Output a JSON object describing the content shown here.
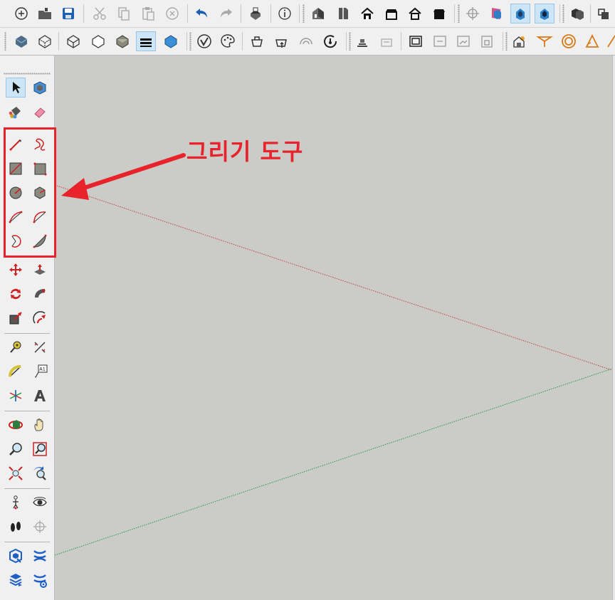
{
  "annotation": {
    "label": "그리기 도구",
    "color": "#e8232b"
  },
  "text_tool_label": "A1",
  "toolbar_top": [
    "new-file-icon",
    "open-folder-icon",
    "save-icon",
    "cut-icon",
    "copy-icon",
    "paste-icon",
    "erase-icon",
    "undo-icon",
    "redo-icon",
    "print-icon",
    "model-info-icon",
    "iso-view-icon",
    "top-view-icon",
    "front-view-icon",
    "right-view-icon",
    "back-view-icon",
    "left-view-icon",
    "previous-view-icon",
    "section-plane-icon",
    "display-section-planes-icon",
    "display-section-cuts-icon",
    "components-icon",
    "groups-icon"
  ],
  "toolbar_styles": [
    "xray-icon",
    "back-edges-icon",
    "wireframe-icon",
    "hidden-line-icon",
    "shaded-icon",
    "shaded-with-textures-icon",
    "monochrome-icon",
    "warehouse-icon",
    "extension-warehouse-icon",
    "share-model-icon",
    "share-component-icon",
    "extension-manager-icon",
    "add-location-icon",
    "toggle-terrain-icon",
    "sandbox-icon",
    "section-fill-icon",
    "photo-match-icon",
    "lock-icon",
    "shadow-settings-icon",
    "fog-icon",
    "soften-icon",
    "protractor-icon"
  ],
  "left_tools": [
    "select-tool",
    "make-component-tool",
    "paint-bucket-tool",
    "eraser-tool",
    "line-tool",
    "freehand-tool",
    "rectangle-tool",
    "rotated-rectangle-tool",
    "circle-tool",
    "polygon-tool",
    "arc-tool",
    "two-point-arc-tool",
    "three-point-arc-tool",
    "pie-tool",
    "move-tool",
    "push-pull-tool",
    "rotate-tool",
    "follow-me-tool",
    "scale-tool",
    "offset-tool",
    "tape-measure-tool",
    "dimension-tool",
    "protractor-tool",
    "text-tool",
    "axes-tool",
    "3d-text-tool",
    "orbit-tool",
    "pan-tool",
    "zoom-tool",
    "zoom-window-tool",
    "zoom-extents-tool",
    "previous-view-tool",
    "position-camera-tool",
    "look-around-tool",
    "walk-tool",
    "section-plane-tool",
    "solid-tools",
    "outer-shell-tool",
    "solid-inspector-tool",
    "trim-tool"
  ]
}
